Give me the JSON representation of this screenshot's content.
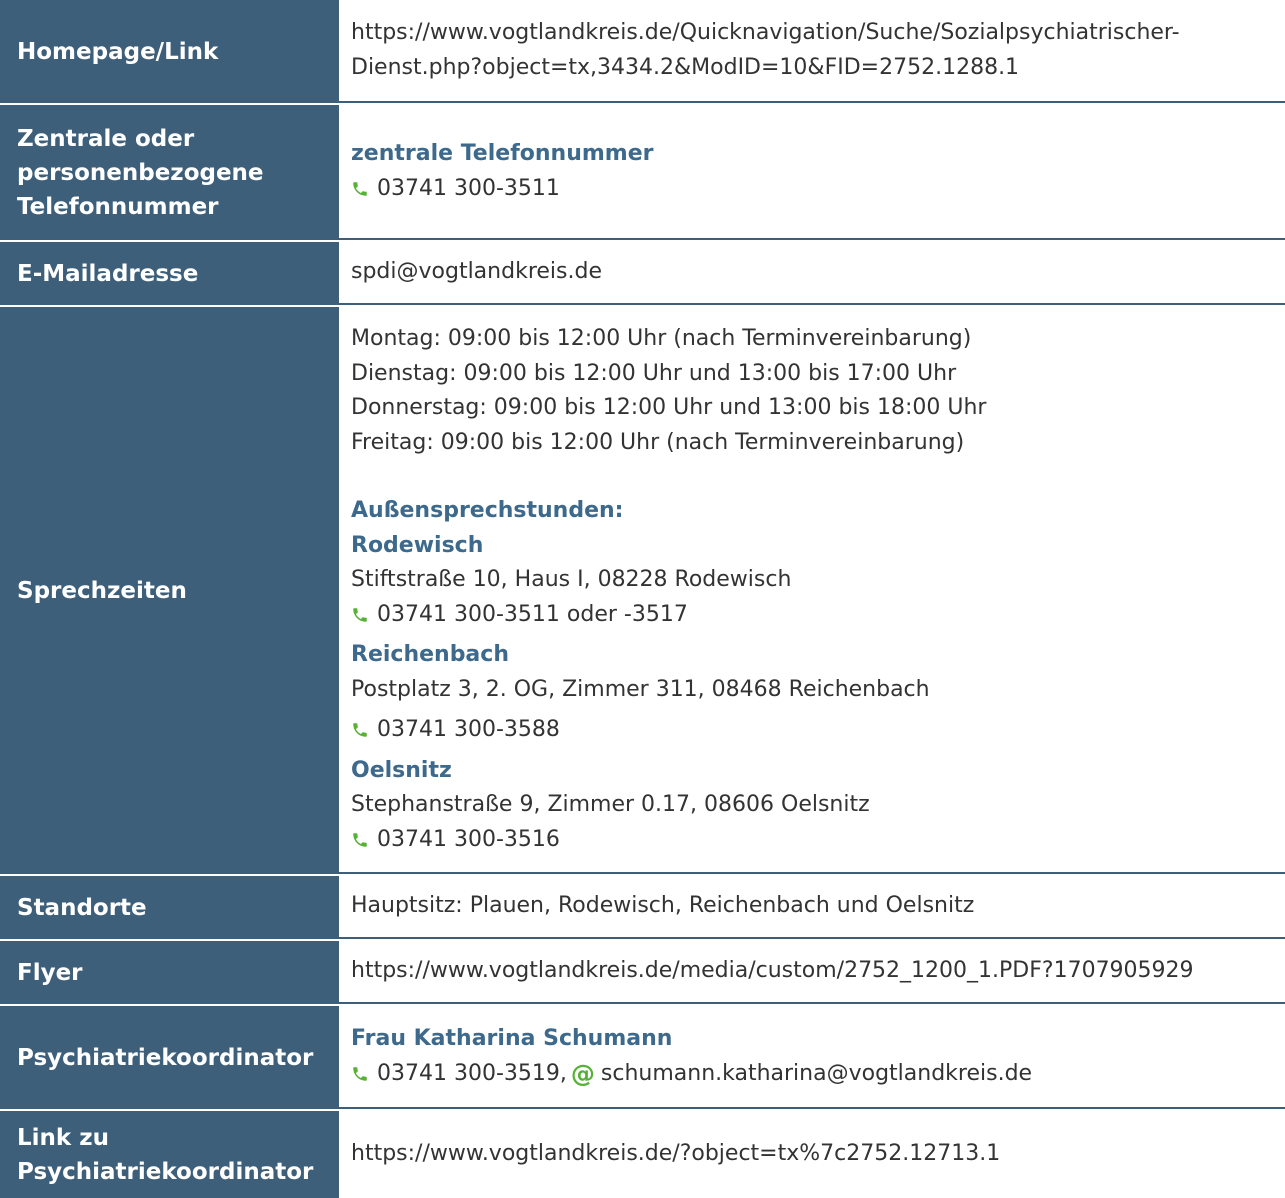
{
  "rows": {
    "homepage": {
      "label": "Homepage/Link",
      "lines": [
        "https://www.vogtlandkreis.de/Quicknavigation/Suche/Sozialpsychiatrischer-",
        "Dienst.php?object=tx,3434.2&ModID=10&FID=2752.1288.1"
      ]
    },
    "telefon": {
      "label_lines": [
        "Zentrale oder",
        "personenbezogene",
        "Telefonnummer"
      ],
      "heading": "zentrale Telefonnummer",
      "phone": "03741 300-3511"
    },
    "email": {
      "label": "E-Mailadresse",
      "value": "spdi@vogtlandkreis.de"
    },
    "sprechzeiten": {
      "label": "Sprechzeiten",
      "hours": [
        "Montag: 09:00 bis 12:00 Uhr (nach Terminvereinbarung)",
        "Dienstag: 09:00 bis 12:00 Uhr und 13:00 bis 17:00 Uhr",
        "Donnerstag: 09:00 bis 12:00 Uhr und 13:00 bis 18:00 Uhr",
        "Freitag: 09:00 bis 12:00 Uhr (nach Terminvereinbarung)"
      ],
      "aussen_heading": "Außensprechstunden:",
      "locations": [
        {
          "name": "Rodewisch",
          "address": "Stiftstraße 10, Haus I, 08228 Rodewisch",
          "phone": "03741 300-3511 oder -3517"
        },
        {
          "name": "Reichenbach",
          "address": "Postplatz 3, 2. OG, Zimmer 311, 08468 Reichenbach",
          "phone": "03741 300-3588"
        },
        {
          "name": "Oelsnitz",
          "address": "Stephanstraße 9, Zimmer 0.17, 08606 Oelsnitz",
          "phone": "03741 300-3516"
        }
      ]
    },
    "standorte": {
      "label": "Standorte",
      "value": "Hauptsitz: Plauen, Rodewisch, Reichenbach und Oelsnitz"
    },
    "flyer": {
      "label": "Flyer",
      "value": "https://www.vogtlandkreis.de/media/custom/2752_1200_1.PDF?1707905929"
    },
    "koordinator": {
      "label": "Psychiatriekoordinator",
      "name": "Frau Katharina Schumann",
      "phone": "03741 300-3519,",
      "email": "schumann.katharina@vogtlandkreis.de"
    },
    "koordinator_link": {
      "label_lines": [
        "Link zu",
        "Psychiatriekoordinator"
      ],
      "value": "https://www.vogtlandkreis.de/?object=tx%7c2752.12713.1"
    }
  },
  "colors": {
    "label_bg": "#3d5f7a",
    "heading_text": "#3d6a8c",
    "icon_green": "#56b135"
  }
}
